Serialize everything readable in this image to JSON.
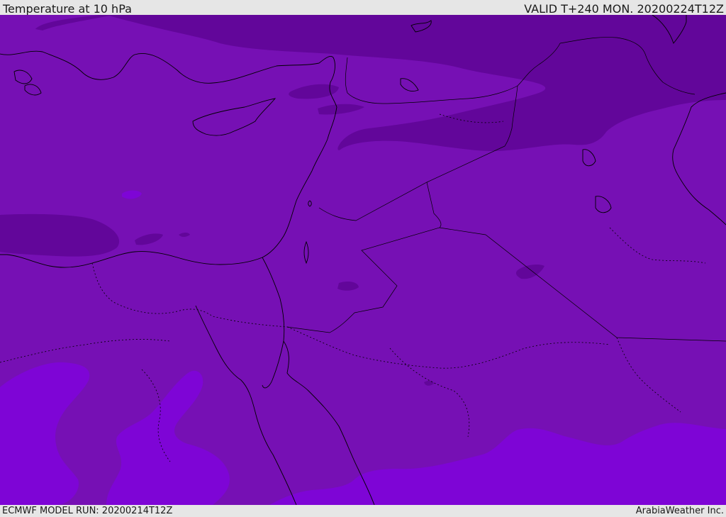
{
  "header": {
    "title": "Temperature at 10 hPa",
    "valid": "VALID T+240 MON. 20200224T12Z"
  },
  "footer": {
    "model_run": "ECMWF MODEL RUN: 20200214T12Z",
    "credit": "ArabiaWeather Inc."
  },
  "colors": {
    "band_base": "#7610b4",
    "band_cold": "#62069a",
    "band_warm": "#7e05d6",
    "coastline": "#000000",
    "bar_bg": "#e6e6e6"
  }
}
